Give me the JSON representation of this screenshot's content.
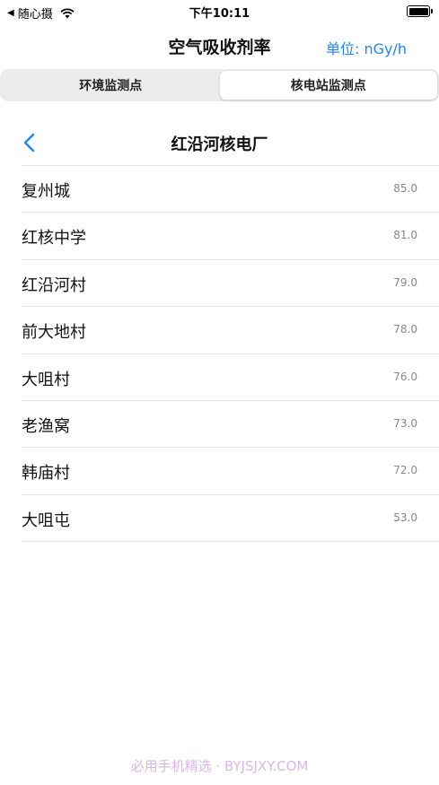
{
  "status_bar": {
    "back_app": "随心摄",
    "time": "下午10:11"
  },
  "nav": {
    "title": "空气吸收剂率",
    "unit": "单位: nGy/h"
  },
  "segments": [
    {
      "label": "环境监测点",
      "active": false
    },
    {
      "label": "核电站监测点",
      "active": true
    }
  ],
  "station": {
    "title": "红沿河核电厂"
  },
  "points": [
    {
      "name": "复州城",
      "value": "85.0"
    },
    {
      "name": "红核中学",
      "value": "81.0"
    },
    {
      "name": "红沿河村",
      "value": "79.0"
    },
    {
      "name": "前大地村",
      "value": "78.0"
    },
    {
      "name": "大咀村",
      "value": "76.0"
    },
    {
      "name": "老渔窝",
      "value": "73.0"
    },
    {
      "name": "韩庙村",
      "value": "72.0"
    },
    {
      "name": "大咀屯",
      "value": "53.0"
    }
  ],
  "watermark": "必用手机精选 · BYJSJXY.COM",
  "colors": {
    "accent": "#1f86ff",
    "segment_bg": "#ececef",
    "value_gray": "#888888"
  }
}
